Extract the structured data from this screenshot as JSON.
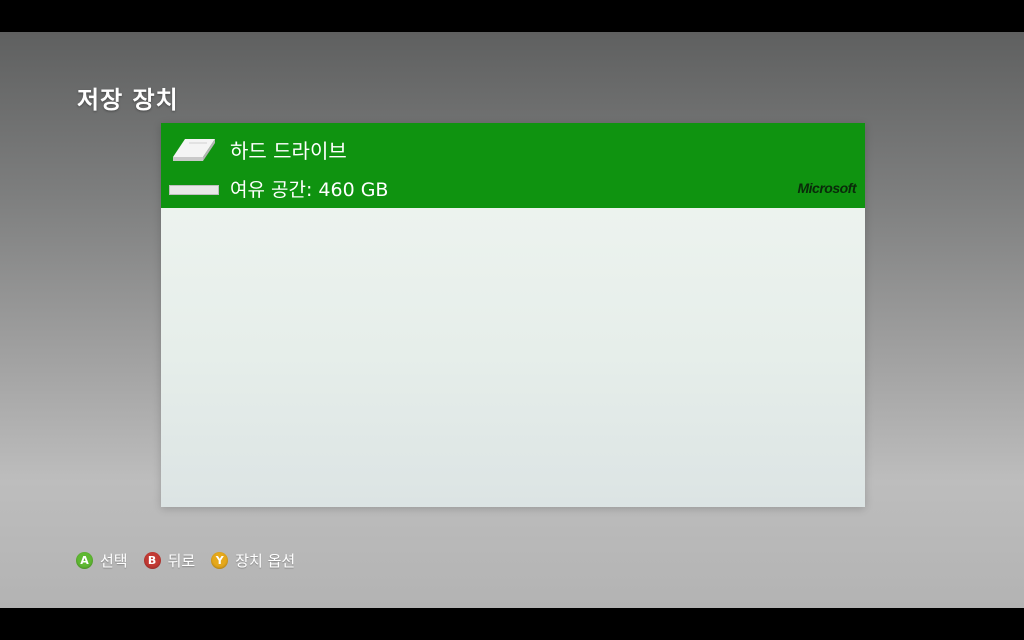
{
  "page": {
    "title": "저장 장치"
  },
  "device": {
    "name": "하드 드라이브",
    "free_space": "여유 공간: 460 GB",
    "brand": "Microsoft",
    "icon": "hard-drive-icon",
    "selected": true,
    "used_fraction": 1.0
  },
  "footer": {
    "hints": [
      {
        "button": "A",
        "label": "선택",
        "color": "#5fb832"
      },
      {
        "button": "B",
        "label": "뒤로",
        "color": "#c23a34"
      },
      {
        "button": "Y",
        "label": "장치 옵션",
        "color": "#e5a81c"
      }
    ]
  },
  "colors": {
    "selection": "#0f9310",
    "panel": "#e8f0ec"
  }
}
